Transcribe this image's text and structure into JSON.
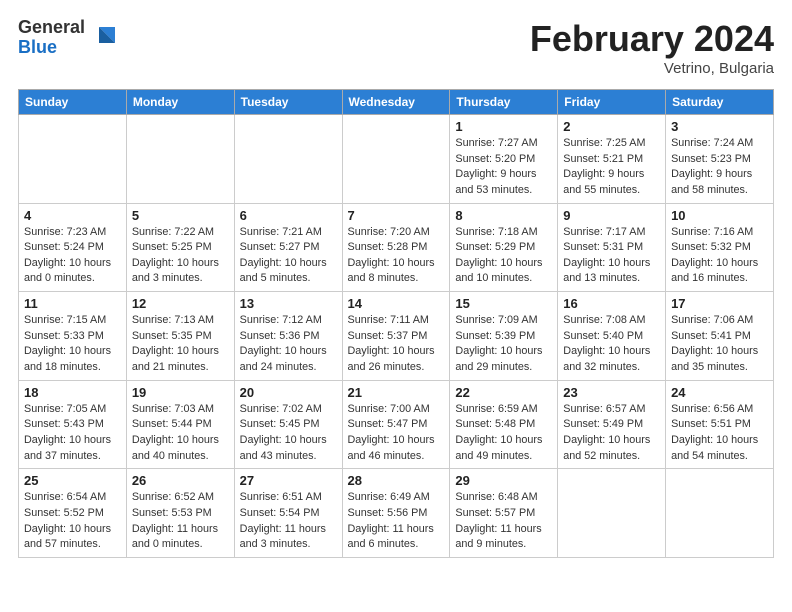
{
  "header": {
    "logo_general": "General",
    "logo_blue": "Blue",
    "title": "February 2024",
    "subtitle": "Vetrino, Bulgaria"
  },
  "days_of_week": [
    "Sunday",
    "Monday",
    "Tuesday",
    "Wednesday",
    "Thursday",
    "Friday",
    "Saturday"
  ],
  "weeks": [
    [
      {
        "day": "",
        "info": ""
      },
      {
        "day": "",
        "info": ""
      },
      {
        "day": "",
        "info": ""
      },
      {
        "day": "",
        "info": ""
      },
      {
        "day": "1",
        "info": "Sunrise: 7:27 AM\nSunset: 5:20 PM\nDaylight: 9 hours\nand 53 minutes."
      },
      {
        "day": "2",
        "info": "Sunrise: 7:25 AM\nSunset: 5:21 PM\nDaylight: 9 hours\nand 55 minutes."
      },
      {
        "day": "3",
        "info": "Sunrise: 7:24 AM\nSunset: 5:23 PM\nDaylight: 9 hours\nand 58 minutes."
      }
    ],
    [
      {
        "day": "4",
        "info": "Sunrise: 7:23 AM\nSunset: 5:24 PM\nDaylight: 10 hours\nand 0 minutes."
      },
      {
        "day": "5",
        "info": "Sunrise: 7:22 AM\nSunset: 5:25 PM\nDaylight: 10 hours\nand 3 minutes."
      },
      {
        "day": "6",
        "info": "Sunrise: 7:21 AM\nSunset: 5:27 PM\nDaylight: 10 hours\nand 5 minutes."
      },
      {
        "day": "7",
        "info": "Sunrise: 7:20 AM\nSunset: 5:28 PM\nDaylight: 10 hours\nand 8 minutes."
      },
      {
        "day": "8",
        "info": "Sunrise: 7:18 AM\nSunset: 5:29 PM\nDaylight: 10 hours\nand 10 minutes."
      },
      {
        "day": "9",
        "info": "Sunrise: 7:17 AM\nSunset: 5:31 PM\nDaylight: 10 hours\nand 13 minutes."
      },
      {
        "day": "10",
        "info": "Sunrise: 7:16 AM\nSunset: 5:32 PM\nDaylight: 10 hours\nand 16 minutes."
      }
    ],
    [
      {
        "day": "11",
        "info": "Sunrise: 7:15 AM\nSunset: 5:33 PM\nDaylight: 10 hours\nand 18 minutes."
      },
      {
        "day": "12",
        "info": "Sunrise: 7:13 AM\nSunset: 5:35 PM\nDaylight: 10 hours\nand 21 minutes."
      },
      {
        "day": "13",
        "info": "Sunrise: 7:12 AM\nSunset: 5:36 PM\nDaylight: 10 hours\nand 24 minutes."
      },
      {
        "day": "14",
        "info": "Sunrise: 7:11 AM\nSunset: 5:37 PM\nDaylight: 10 hours\nand 26 minutes."
      },
      {
        "day": "15",
        "info": "Sunrise: 7:09 AM\nSunset: 5:39 PM\nDaylight: 10 hours\nand 29 minutes."
      },
      {
        "day": "16",
        "info": "Sunrise: 7:08 AM\nSunset: 5:40 PM\nDaylight: 10 hours\nand 32 minutes."
      },
      {
        "day": "17",
        "info": "Sunrise: 7:06 AM\nSunset: 5:41 PM\nDaylight: 10 hours\nand 35 minutes."
      }
    ],
    [
      {
        "day": "18",
        "info": "Sunrise: 7:05 AM\nSunset: 5:43 PM\nDaylight: 10 hours\nand 37 minutes."
      },
      {
        "day": "19",
        "info": "Sunrise: 7:03 AM\nSunset: 5:44 PM\nDaylight: 10 hours\nand 40 minutes."
      },
      {
        "day": "20",
        "info": "Sunrise: 7:02 AM\nSunset: 5:45 PM\nDaylight: 10 hours\nand 43 minutes."
      },
      {
        "day": "21",
        "info": "Sunrise: 7:00 AM\nSunset: 5:47 PM\nDaylight: 10 hours\nand 46 minutes."
      },
      {
        "day": "22",
        "info": "Sunrise: 6:59 AM\nSunset: 5:48 PM\nDaylight: 10 hours\nand 49 minutes."
      },
      {
        "day": "23",
        "info": "Sunrise: 6:57 AM\nSunset: 5:49 PM\nDaylight: 10 hours\nand 52 minutes."
      },
      {
        "day": "24",
        "info": "Sunrise: 6:56 AM\nSunset: 5:51 PM\nDaylight: 10 hours\nand 54 minutes."
      }
    ],
    [
      {
        "day": "25",
        "info": "Sunrise: 6:54 AM\nSunset: 5:52 PM\nDaylight: 10 hours\nand 57 minutes."
      },
      {
        "day": "26",
        "info": "Sunrise: 6:52 AM\nSunset: 5:53 PM\nDaylight: 11 hours\nand 0 minutes."
      },
      {
        "day": "27",
        "info": "Sunrise: 6:51 AM\nSunset: 5:54 PM\nDaylight: 11 hours\nand 3 minutes."
      },
      {
        "day": "28",
        "info": "Sunrise: 6:49 AM\nSunset: 5:56 PM\nDaylight: 11 hours\nand 6 minutes."
      },
      {
        "day": "29",
        "info": "Sunrise: 6:48 AM\nSunset: 5:57 PM\nDaylight: 11 hours\nand 9 minutes."
      },
      {
        "day": "",
        "info": ""
      },
      {
        "day": "",
        "info": ""
      }
    ]
  ]
}
